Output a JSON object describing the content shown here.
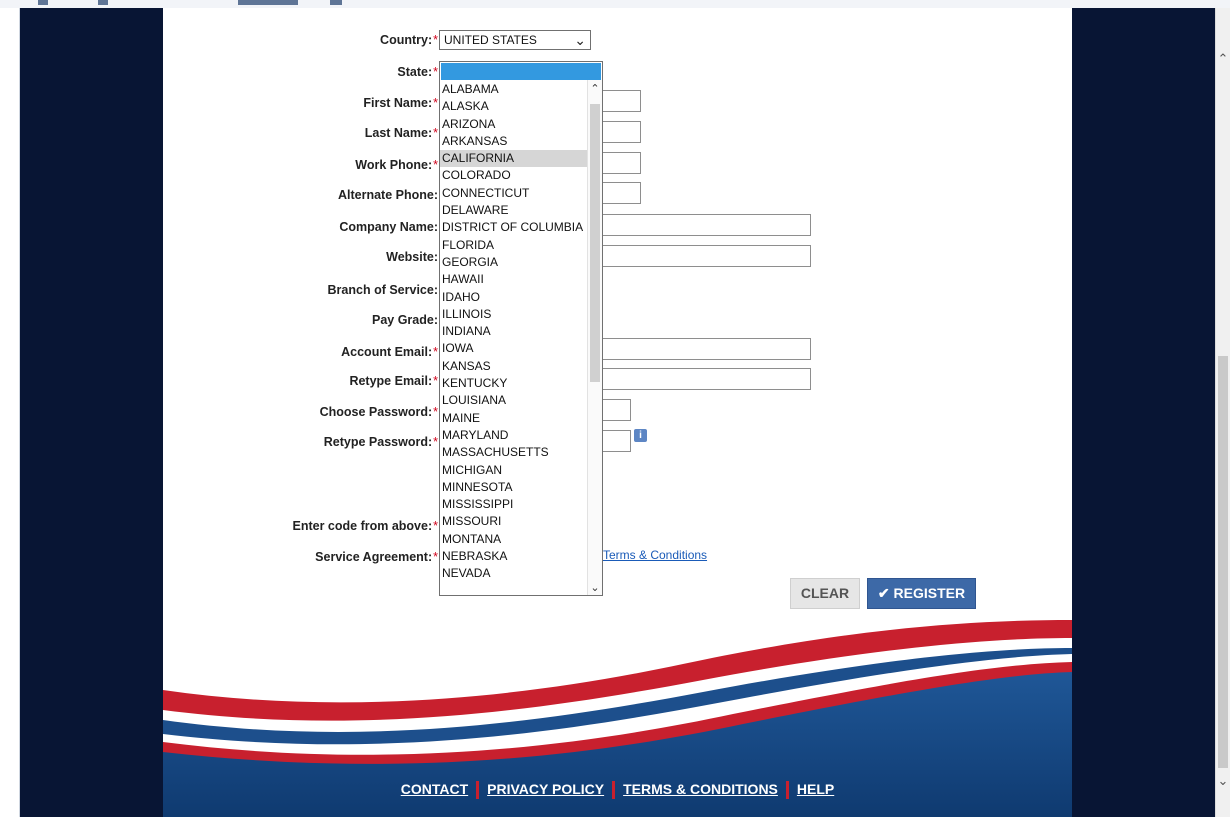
{
  "form": {
    "country": {
      "label": "Country:",
      "value": "UNITED STATES"
    },
    "state": {
      "label": "State:"
    },
    "first_name": {
      "label": "First Name:"
    },
    "last_name": {
      "label": "Last Name:"
    },
    "work_phone": {
      "label": "Work Phone:"
    },
    "alternate_phone": {
      "label": "Alternate Phone:"
    },
    "company_name": {
      "label": "Company Name:"
    },
    "website": {
      "label": "Website:"
    },
    "branch_of_service": {
      "label": "Branch of Service:"
    },
    "pay_grade": {
      "label": "Pay Grade:"
    },
    "account_email": {
      "label": "Account Email:"
    },
    "retype_email": {
      "label": "Retype Email:"
    },
    "choose_password": {
      "label": "Choose Password:"
    },
    "retype_password": {
      "label": "Retype Password:"
    },
    "captcha": {
      "label": "Enter code from above:"
    },
    "service_agreement": {
      "label": "Service Agreement:",
      "link": "Terms & Conditions"
    },
    "required_marker": "*"
  },
  "state_options": [
    "ALABAMA",
    "ALASKA",
    "ARIZONA",
    "ARKANSAS",
    "CALIFORNIA",
    "COLORADO",
    "CONNECTICUT",
    "DELAWARE",
    "DISTRICT OF COLUMBIA",
    "FLORIDA",
    "GEORGIA",
    "HAWAII",
    "IDAHO",
    "ILLINOIS",
    "INDIANA",
    "IOWA",
    "KANSAS",
    "KENTUCKY",
    "LOUISIANA",
    "MAINE",
    "MARYLAND",
    "MASSACHUSETTS",
    "MICHIGAN",
    "MINNESOTA",
    "MISSISSIPPI",
    "MISSOURI",
    "MONTANA",
    "NEBRASKA",
    "NEVADA"
  ],
  "state_hovered": "CALIFORNIA",
  "buttons": {
    "clear": "CLEAR",
    "register": "REGISTER",
    "register_icon": "checkmark-icon"
  },
  "info_icon": "info-icon",
  "footer": {
    "links": [
      "CONTACT",
      "PRIVACY POLICY",
      "TERMS & CONDITIONS",
      "HELP"
    ]
  },
  "colors": {
    "navy": "#081534",
    "link": "#1a5bb8",
    "register_bg": "#3d69a7",
    "required": "#d0021b",
    "swoosh_red": "#c8202e",
    "swoosh_blue": "#1d4f8c",
    "dropdown_highlight": "#3399e0"
  }
}
